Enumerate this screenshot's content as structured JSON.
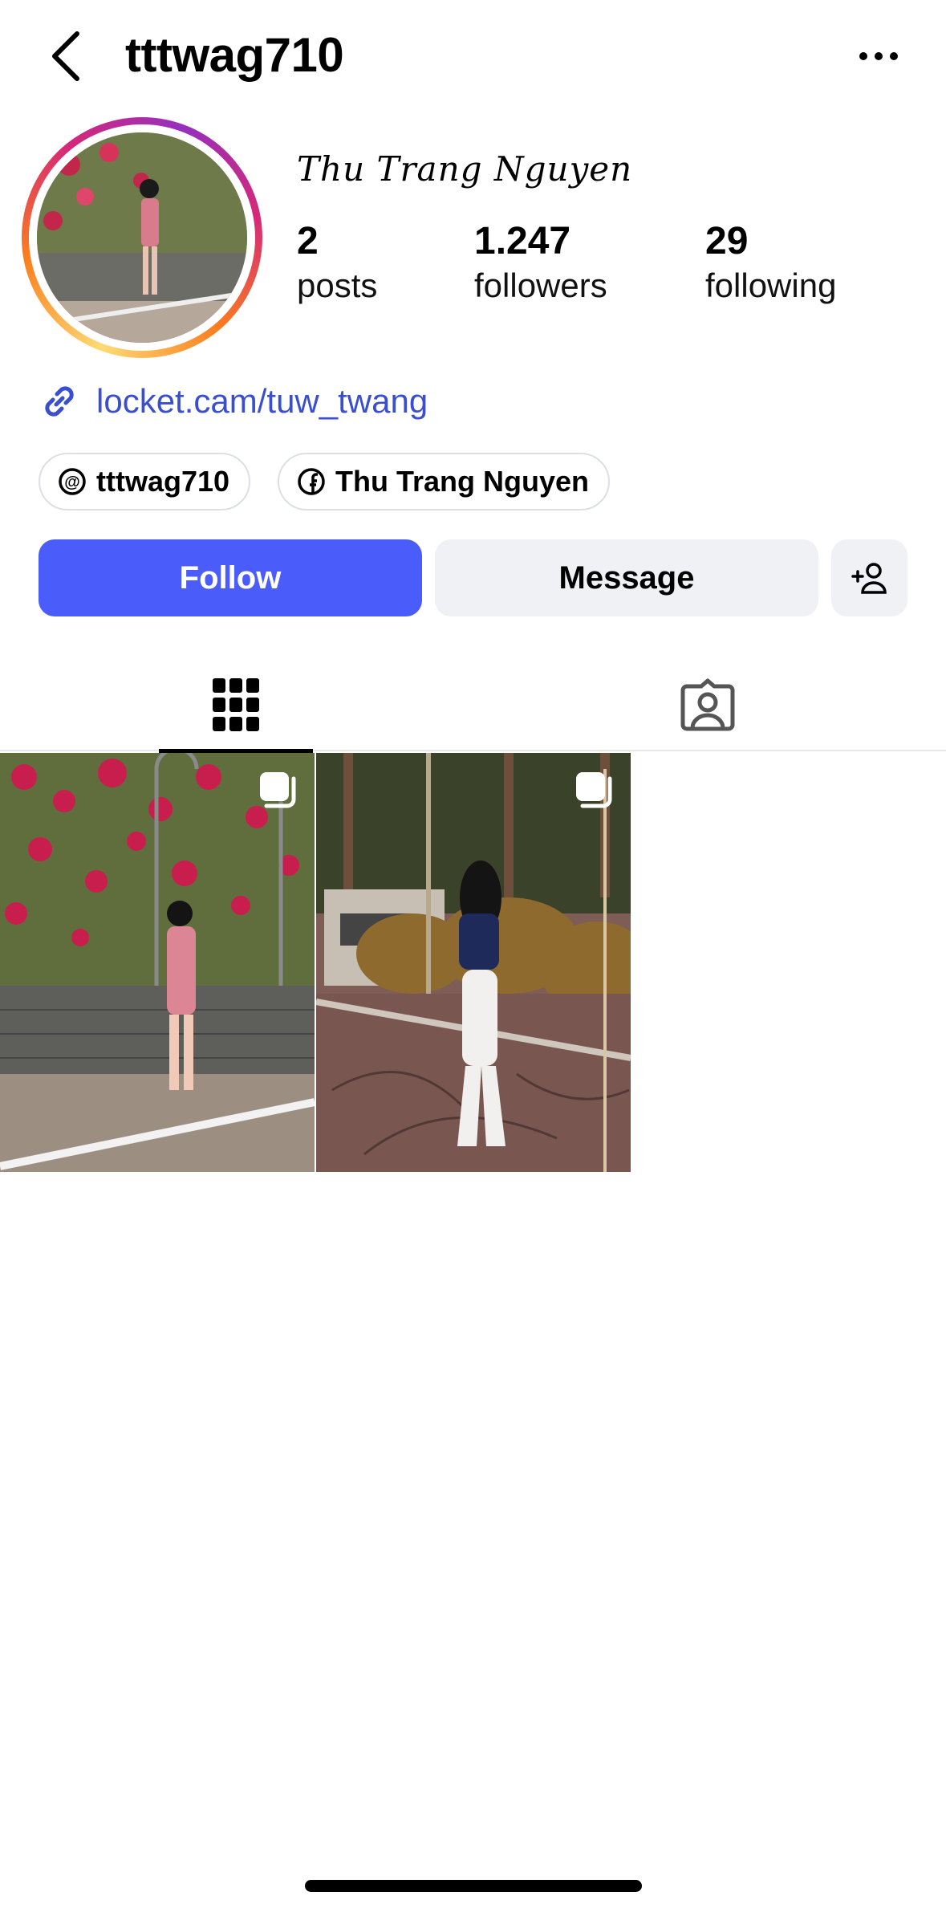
{
  "header": {
    "username": "tttwag710",
    "back_icon": "chevron-left-icon",
    "more_icon": "ellipsis-icon"
  },
  "profile": {
    "display_name": "Thu Trang Nguyen",
    "stats": [
      {
        "value": "2",
        "label": "posts"
      },
      {
        "value": "1.247",
        "label": "followers"
      },
      {
        "value": "29",
        "label": "following"
      }
    ],
    "link": "locket.cam/tuw_twang",
    "chips": [
      {
        "icon": "threads-icon",
        "label": "tttwag710"
      },
      {
        "icon": "facebook-icon",
        "label": "Thu Trang Nguyen"
      }
    ]
  },
  "actions": {
    "follow_label": "Follow",
    "message_label": "Message",
    "add_person_icon": "add-person-icon"
  },
  "tabs": [
    {
      "icon": "grid-icon",
      "active": true
    },
    {
      "icon": "tagged-icon",
      "active": false
    }
  ],
  "posts": [
    {
      "type": "reel"
    },
    {
      "type": "reel"
    }
  ],
  "colors": {
    "accent": "#4a5cf9",
    "link": "#3a4fcf",
    "button_secondary": "#eff1f4"
  }
}
